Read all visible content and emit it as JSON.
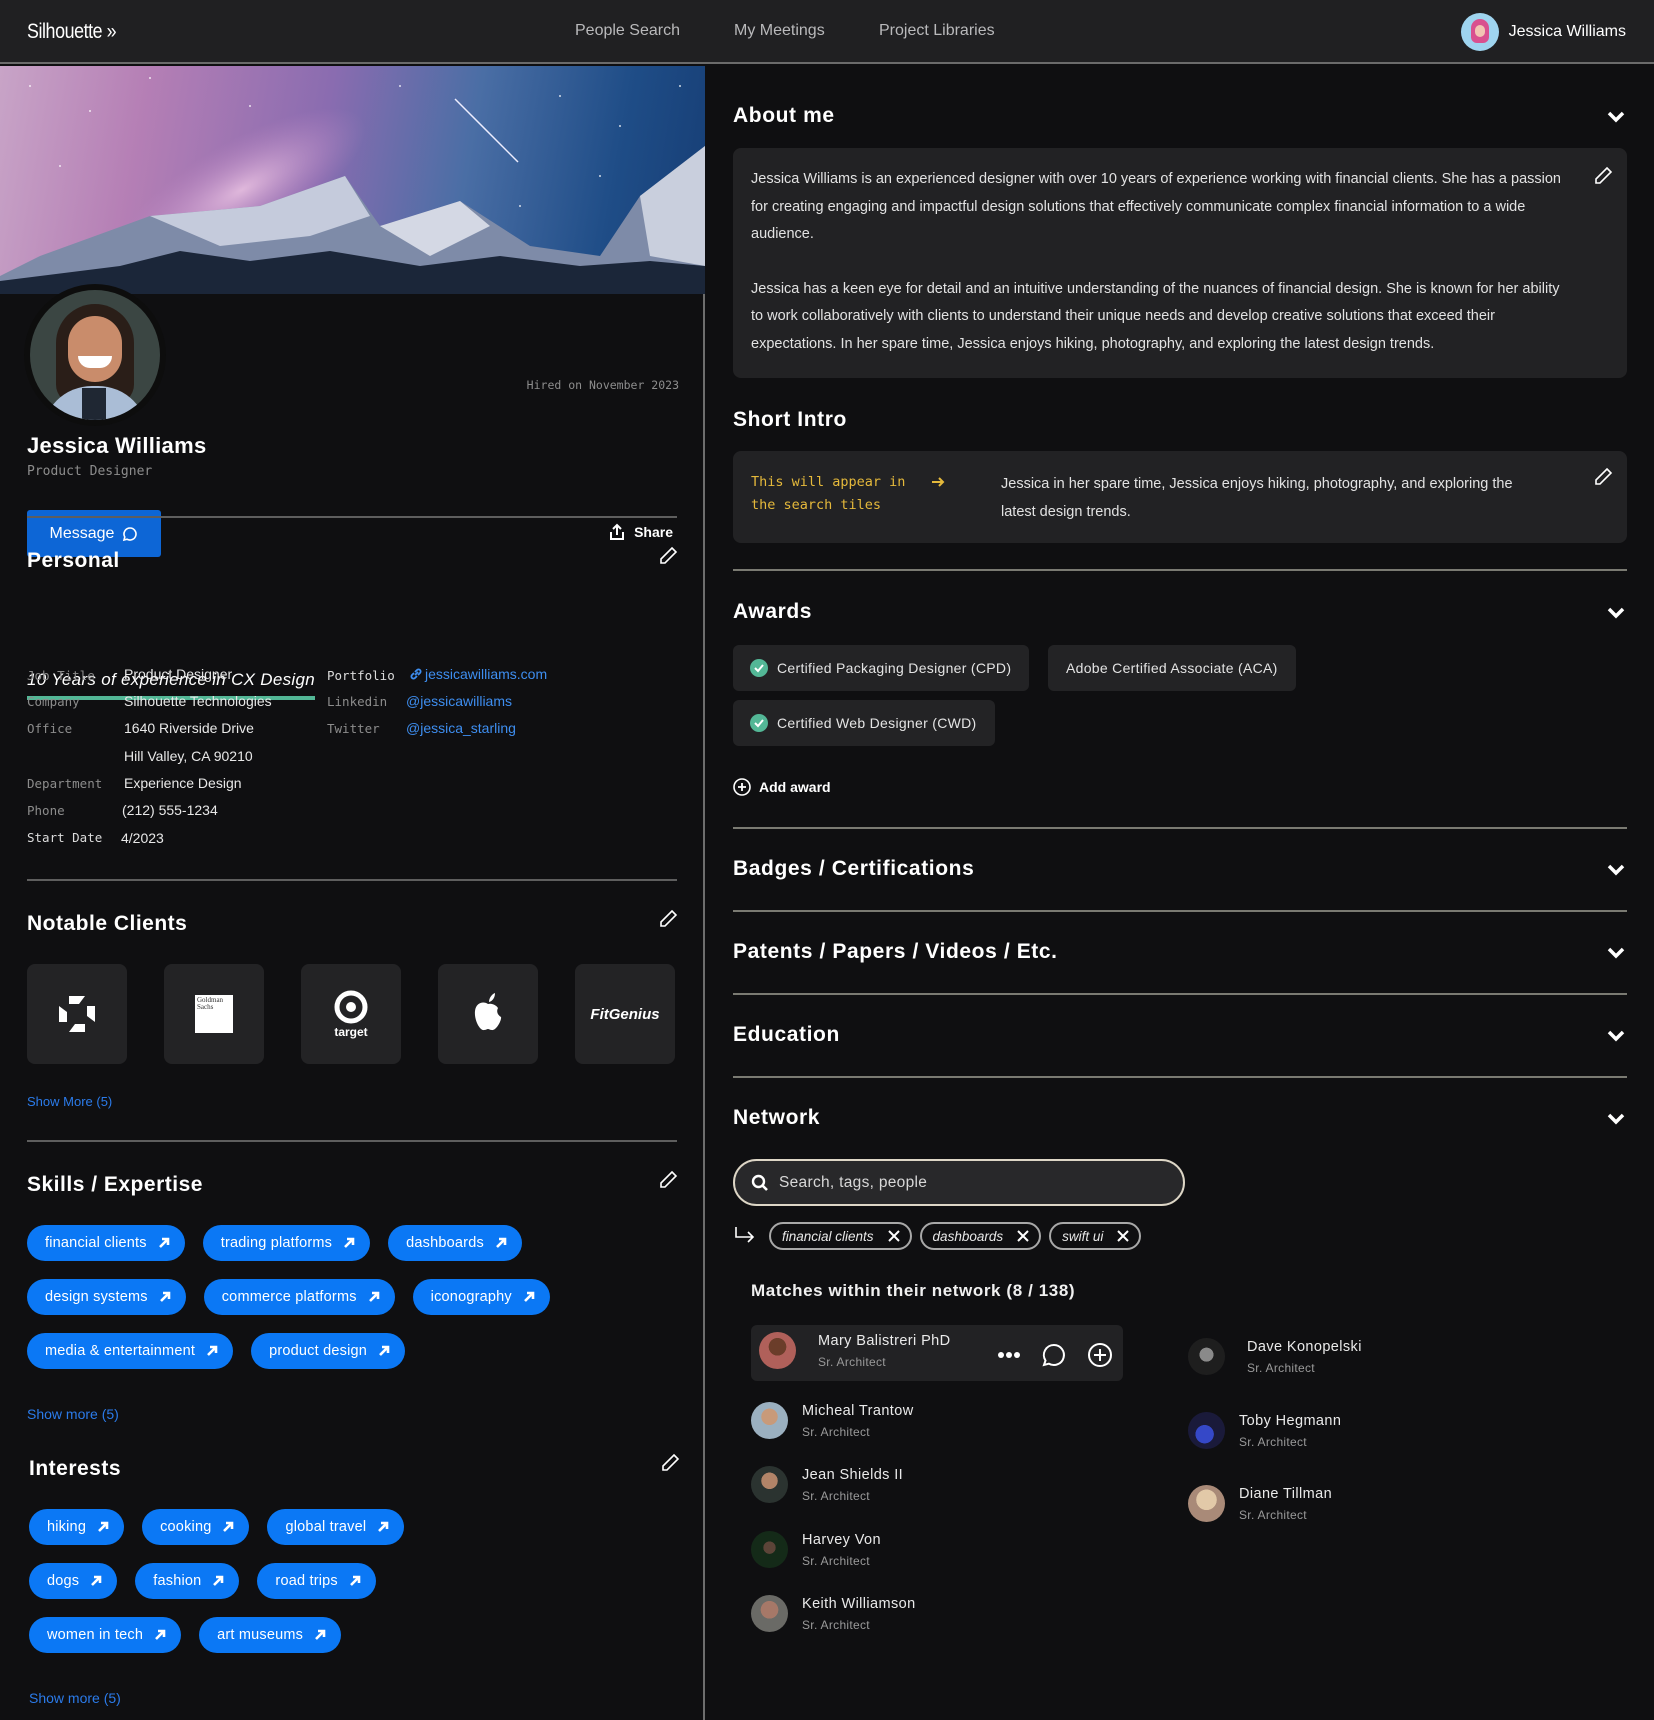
{
  "header": {
    "logo": "Silhouette »",
    "nav": [
      "People Search",
      "My Meetings",
      "Project Libraries"
    ],
    "user_name": "Jessica Williams"
  },
  "profile": {
    "hired": "Hired on November 2023",
    "name": "Jessica Williams",
    "title": "Product Designer",
    "message_label": "Message",
    "share_label": "Share"
  },
  "personal": {
    "title": "Personal",
    "experience": "10 Years of experience in CX Design",
    "fields": {
      "job_title_label": "Job Title",
      "job_title": "Product Designer",
      "company_label": "Company",
      "company": "Silhouette Technologies",
      "office_label": "Office",
      "office_line1": "1640 Riverside Drive",
      "office_line2": "Hill Valley, CA 90210",
      "department_label": "Department",
      "department": "Experience Design",
      "phone_label": "Phone",
      "phone": "(212) 555-1234",
      "start_label": "Start Date",
      "start": "4/2023",
      "portfolio_label": "Portfolio",
      "portfolio": "jessicawilliams.com",
      "linkedin_label": "Linkedin",
      "linkedin": "@jessicawilliams",
      "twitter_label": "Twitter",
      "twitter": "@jessica_starling"
    }
  },
  "clients": {
    "title": "Notable Clients",
    "items": [
      "chase-logo",
      "goldman-sachs-logo",
      "target-logo",
      "apple-logo",
      "FitGenius"
    ],
    "goldman_text": "Goldman Sachs",
    "target_text": "target",
    "show_more": "Show More (5)"
  },
  "skills": {
    "title": "Skills / Expertise",
    "items": [
      "financial clients",
      "trading platforms",
      "dashboards",
      "design systems",
      "commerce platforms",
      "iconography",
      "media & entertainment",
      "product design"
    ],
    "show_more": "Show more (5)"
  },
  "interests": {
    "title": "Interests",
    "items": [
      "hiking",
      "cooking",
      "global travel",
      "dogs",
      "fashion",
      "road trips",
      "women in tech",
      "art museums"
    ],
    "show_more": "Show more (5)"
  },
  "about": {
    "title": "About me",
    "p1": "Jessica Williams is an experienced designer with over 10 years of experience working with financial clients. She has a passion for creating engaging and impactful design solutions that effectively communicate complex financial information to a wide audience.",
    "p2": "Jessica has a keen eye for detail and an intuitive understanding of the nuances of financial design. She is known for her ability to work collaboratively with clients to understand their unique needs and develop creative solutions that exceed their expectations. In her spare time, Jessica enjoys hiking, photography, and exploring the latest design trends."
  },
  "intro": {
    "title": "Short Intro",
    "note": "This will appear in the search tiles",
    "text": "Jessica in her spare time, Jessica enjoys hiking, photography, and exploring the latest design trends."
  },
  "awards": {
    "title": "Awards",
    "items": [
      {
        "label": "Certified Packaging Designer (CPD)",
        "verified": true
      },
      {
        "label": "Adobe Certified Associate (ACA)",
        "verified": false
      },
      {
        "label": "Certified Web Designer (CWD)",
        "verified": true
      }
    ],
    "add_label": "Add award"
  },
  "sections": [
    "Badges / Certifications",
    "Patents / Papers / Videos / Etc.",
    "Education"
  ],
  "network": {
    "title": "Network",
    "search_placeholder": "Search, tags, people",
    "filters": [
      "financial clients",
      "dashboards",
      "swift ui"
    ],
    "matches": "Matches within their network (8 / 138)",
    "people": [
      {
        "name": "Mary Balistreri PhD",
        "role": "Sr. Architect"
      },
      {
        "name": "Micheal Trantow",
        "role": "Sr. Architect"
      },
      {
        "name": "Jean Shields II",
        "role": "Sr. Architect"
      },
      {
        "name": "Harvey Von",
        "role": "Sr. Architect"
      },
      {
        "name": "Keith Williamson",
        "role": "Sr. Architect"
      },
      {
        "name": "Dave Konopelski",
        "role": "Sr. Architect"
      },
      {
        "name": "Toby Hegmann",
        "role": "Sr. Architect"
      },
      {
        "name": "Diane Tillman",
        "role": "Sr. Architect"
      }
    ]
  },
  "colors": {
    "accent": "#0b78f5",
    "button": "#0d66d6",
    "link": "#3e8ef0",
    "success": "#53b796",
    "note": "#e5b93b"
  }
}
